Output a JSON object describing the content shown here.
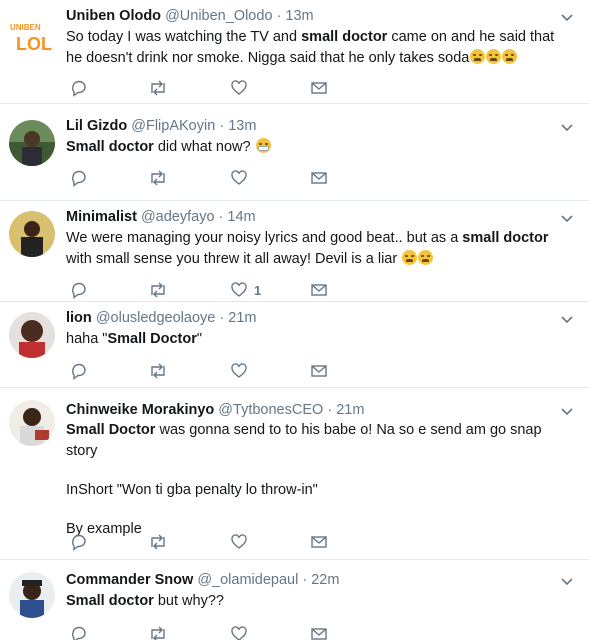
{
  "tweets": [
    {
      "name": "Uniben Olodo",
      "handle": "@Uniben_Olodo",
      "sep": "·",
      "time": "13m",
      "avatar_text": "UNIBEN",
      "avatar_text2": "LOL",
      "segments": [
        [
          {
            "t": "So today I was watching the TV and ",
            "b": false
          },
          {
            "t": "small doctor",
            "b": true
          },
          {
            "t": " came on and he said that he doesn't drink nor smoke. Nigga said that he only takes soda",
            "b": false
          },
          {
            "emoji": "weary-face-emoji"
          },
          {
            "emoji": "weary-face-emoji"
          },
          {
            "emoji": "weary-face-emoji"
          }
        ]
      ],
      "like_count": ""
    },
    {
      "name": "Lil Gizdo",
      "handle": "@FlipAKoyin",
      "sep": "·",
      "time": "13m",
      "segments": [
        [
          {
            "t": "Small doctor",
            "b": true
          },
          {
            "t": " did what now? ",
            "b": false
          },
          {
            "emoji": "face-with-mask-emoji"
          }
        ]
      ],
      "like_count": ""
    },
    {
      "name": "Minimalist",
      "handle": "@adeyfayo",
      "sep": "·",
      "time": "14m",
      "segments": [
        [
          {
            "t": "We were managing your noisy lyrics and good beat.. but as a ",
            "b": false
          },
          {
            "t": "small doctor",
            "b": true
          },
          {
            "t": " with small sense you threw it all away! Devil is a liar ",
            "b": false
          },
          {
            "emoji": "weary-face-emoji"
          },
          {
            "emoji": "weary-face-emoji"
          }
        ]
      ],
      "like_count": "1"
    },
    {
      "name": "lion",
      "handle": "@olusledgeolaoye",
      "sep": "·",
      "time": "21m",
      "segments": [
        [
          {
            "t": "haha \"",
            "b": false
          },
          {
            "t": "Small Doctor",
            "b": true
          },
          {
            "t": "\"",
            "b": false
          }
        ]
      ],
      "like_count": ""
    },
    {
      "name": "Chinweike Morakinyo",
      "handle": "@TytbonesCEO",
      "sep": "·",
      "time": "21m",
      "segments": [
        [
          {
            "t": "Small Doctor",
            "b": true
          },
          {
            "t": " was gonna send to to his babe o! Na so e send am go snap story",
            "b": false
          }
        ],
        [
          {
            "t": "InShort \"Won ti gba penalty lo throw-in\"",
            "b": false
          }
        ],
        [
          {
            "t": "By example",
            "b": false
          }
        ]
      ],
      "like_count": ""
    },
    {
      "name": "Commander Snow",
      "handle": "@_olamidepaul",
      "sep": "·",
      "time": "22m",
      "segments": [
        [
          {
            "t": "Small doctor",
            "b": true
          },
          {
            "t": " but why??",
            "b": false
          }
        ]
      ],
      "like_count": ""
    }
  ],
  "colors": {
    "text": "#14171a",
    "muted": "#657786",
    "divider": "#e1e8ed",
    "logo_orange": "#f7931e"
  },
  "icons": [
    "reply-icon",
    "retweet-icon",
    "like-icon",
    "direct-message-icon",
    "chevron-down-icon"
  ]
}
